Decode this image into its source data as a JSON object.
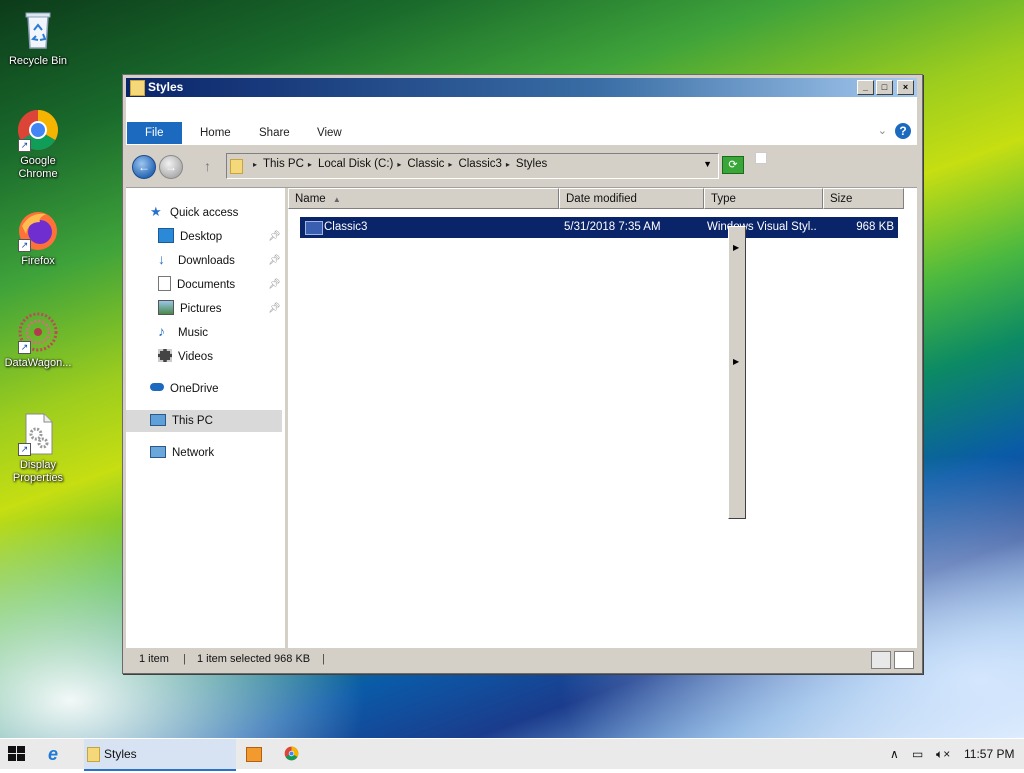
{
  "desktop": {
    "icons": [
      {
        "label": "Recycle Bin"
      },
      {
        "label": "Google Chrome"
      },
      {
        "label": "Firefox"
      },
      {
        "label": "DataWagon..."
      },
      {
        "label": "Display Properties"
      }
    ]
  },
  "window": {
    "title": "Styles",
    "controls": {
      "minimize": "_",
      "maximize": "□",
      "close": "×"
    },
    "ribbon": {
      "tabs": [
        "File",
        "Home",
        "Share",
        "View"
      ],
      "help": "?"
    },
    "address": {
      "crumbs": [
        "This PC",
        "Local Disk (C:)",
        "Classic",
        "Classic3",
        "Styles"
      ]
    },
    "nav": {
      "quick_access": "Quick access",
      "quick_items": [
        {
          "label": "Desktop",
          "pinned": true
        },
        {
          "label": "Downloads",
          "pinned": true
        },
        {
          "label": "Documents",
          "pinned": true
        },
        {
          "label": "Pictures",
          "pinned": true
        },
        {
          "label": "Music",
          "pinned": false
        },
        {
          "label": "Videos",
          "pinned": false
        }
      ],
      "onedrive": "OneDrive",
      "this_pc": "This PC",
      "network": "Network",
      "selected": "This PC"
    },
    "columns": [
      "Name",
      "Date modified",
      "Type",
      "Size"
    ],
    "files": [
      {
        "name": "Classic3",
        "date": "5/31/2018 7:35 AM",
        "type": "Windows Visual Styl...",
        "size": "968 KB",
        "selected": true
      }
    ],
    "status": {
      "count": "1 item",
      "selection": "1 item selected  968 KB"
    }
  },
  "taskbar": {
    "active_window": "Styles",
    "tray": {
      "time": "11:57 PM"
    }
  }
}
